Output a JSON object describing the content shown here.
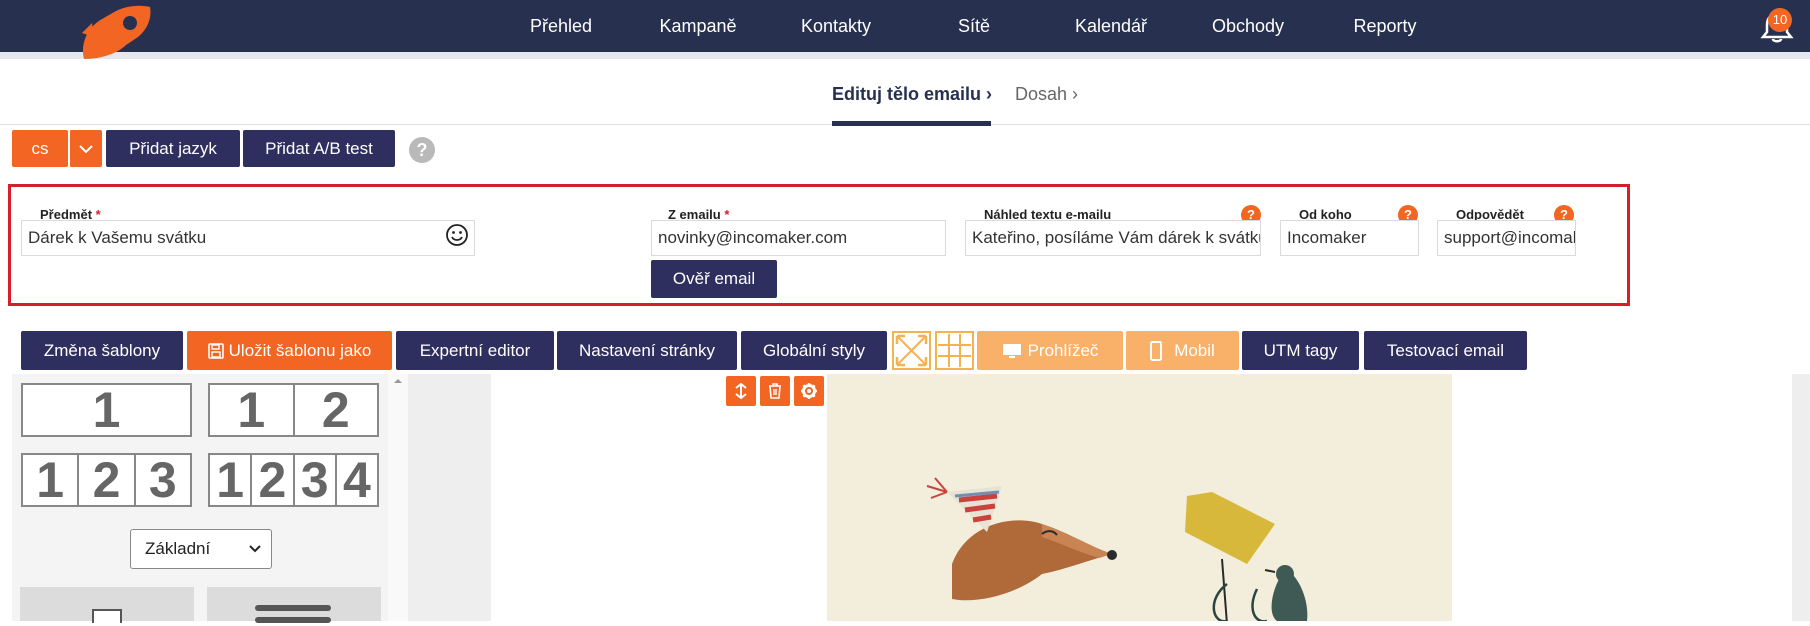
{
  "nav": {
    "items": [
      "Přehled",
      "Kampaně",
      "Kontakty",
      "Sítě",
      "Kalendář",
      "Obchody",
      "Reporty"
    ],
    "notification_count": "10"
  },
  "steps": {
    "active": "Edituj tělo emailu",
    "next": "Dosah"
  },
  "language": {
    "current": "cs",
    "add_language": "Přidat jazyk",
    "add_ab_test": "Přidat A/B test",
    "help": "?"
  },
  "form": {
    "subject_label": "Předmět",
    "subject_value": "Dárek k Vašemu svátku",
    "from_email_label": "Z emailu",
    "from_email_value": "novinky@incomaker.com",
    "verify_button": "Ověř email",
    "preview_label": "Náhled textu e-mailu",
    "preview_value": "Kateřino, posíláme Vám dárek k svátku",
    "from_name_label": "Od koho",
    "from_name_value": "Incomaker",
    "reply_label": "Odpovědět",
    "reply_value": "support@incomaker.com",
    "required_mark": "*",
    "help_mark": "?"
  },
  "toolbar": {
    "change_template": "Změna šablony",
    "save_template_as": "Uložit šablonu jako",
    "expert_editor": "Expertní editor",
    "page_settings": "Nastavení stránky",
    "global_styles": "Globální styly",
    "browser": "Prohlížeč",
    "mobile": "Mobil",
    "utm_tags": "UTM tagy",
    "test_email": "Testovací email"
  },
  "blocks": {
    "layouts": [
      [
        "1"
      ],
      [
        "1",
        "2"
      ],
      [
        "1",
        "2",
        "3"
      ],
      [
        "1",
        "2",
        "3",
        "4"
      ]
    ],
    "style_select": "Základní"
  },
  "colors": {
    "navy": "#27304f",
    "button_navy": "#2e2f5e",
    "orange": "#f26522",
    "light_orange": "#f9b068",
    "highlight_red": "#d71f2b"
  }
}
